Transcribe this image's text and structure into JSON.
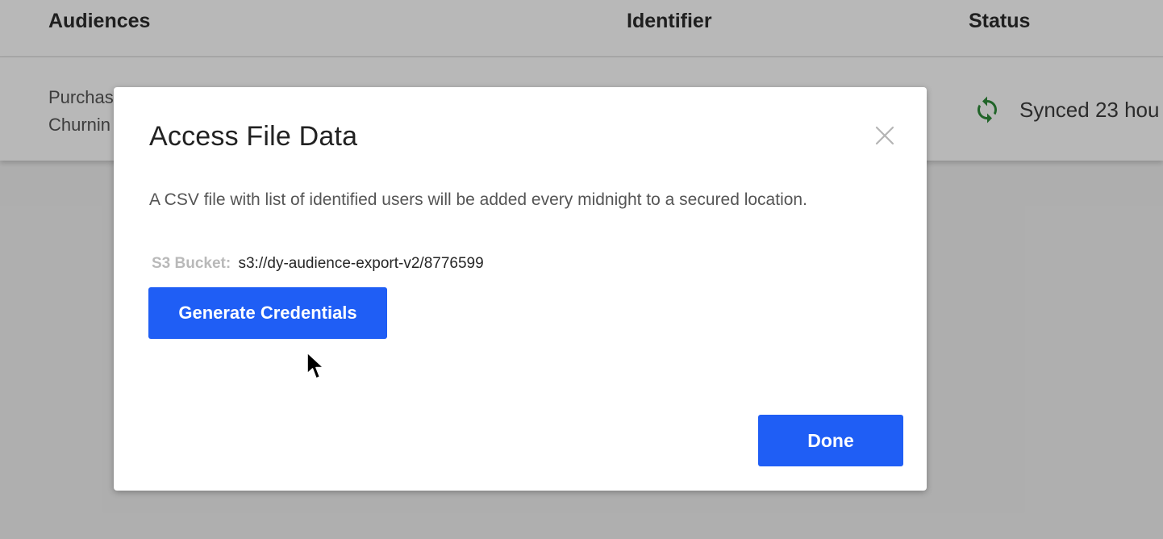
{
  "table": {
    "headers": {
      "audiences": "Audiences",
      "identifier": "Identifier",
      "status": "Status"
    },
    "row": {
      "audience_line1": "Purchas",
      "audience_line2": "Churnin",
      "status_icon": "sync-icon",
      "status_text": "Synced 23 hou"
    }
  },
  "modal": {
    "title": "Access File Data",
    "close_icon": "close-icon",
    "description": "A CSV file with list of identified users will be added every midnight to a secured location.",
    "bucket_label": "S3 Bucket:",
    "bucket_value": "s3://dy-audience-export-v2/8776599",
    "generate_button": "Generate Credentials",
    "done_button": "Done"
  },
  "colors": {
    "primary": "#1f5ef5",
    "sync_green": "#2e8b3a",
    "overlay": "rgba(0,0,0,0.28)"
  }
}
